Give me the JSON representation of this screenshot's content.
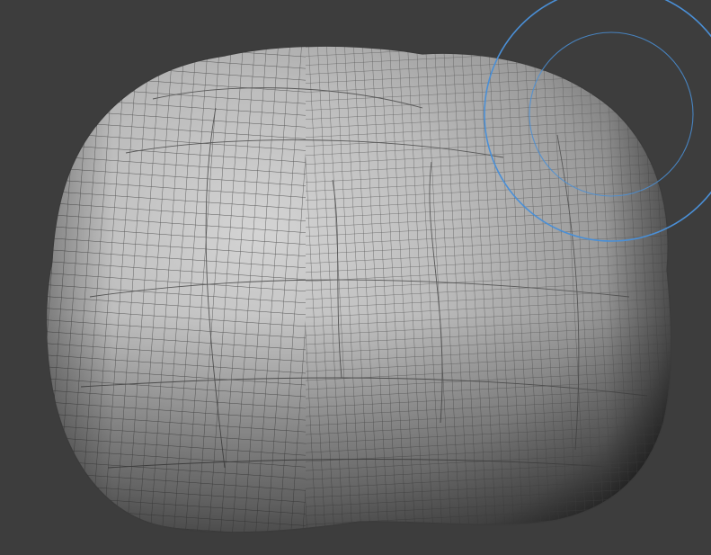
{
  "viewport": {
    "mode": "sculpt",
    "background_color": "#3d3d3d"
  },
  "mesh": {
    "object": "blob",
    "shading": "solid-gray",
    "wireframe_overlay": true,
    "wire_color": "#5a5a5a",
    "highlight_color": "#d4d4d4",
    "shadow_color": "#3a3a3a"
  },
  "brush_cursor": {
    "color": "#4a8fd6",
    "rings": [
      "outer-radius",
      "inner-falloff"
    ]
  }
}
